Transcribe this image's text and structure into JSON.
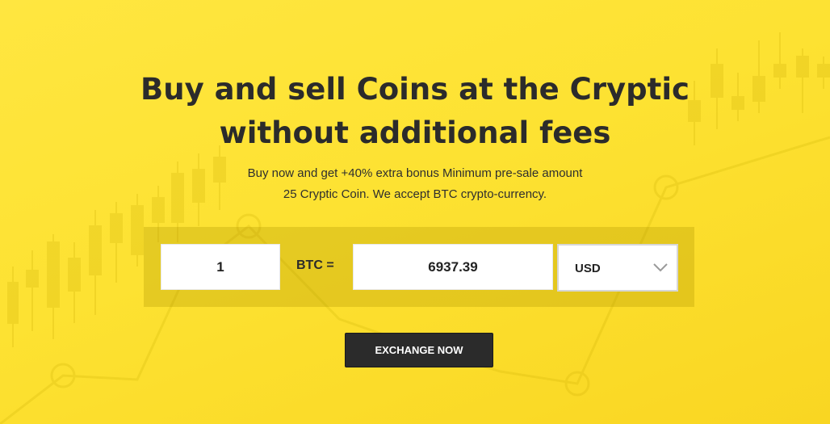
{
  "hero": {
    "headline_line1": "Buy and sell Coins at the Cryptic",
    "headline_line2": "without additional fees",
    "subtext_line1": "Buy now and get +40% extra bonus Minimum pre-sale amount",
    "subtext_line2": "25 Cryptic Coin. We accept BTC crypto-currency."
  },
  "converter": {
    "amount_value": "1",
    "from_label": "BTC =",
    "result_value": "6937.39",
    "currency_selected": "USD",
    "dropdown_icon": "chevron-down-icon"
  },
  "cta": {
    "label": "EXCHANGE NOW"
  },
  "colors": {
    "background": "#fde232",
    "panel": "#c9a800",
    "button_bg": "#2b2b2b",
    "button_text": "#ffffff"
  }
}
